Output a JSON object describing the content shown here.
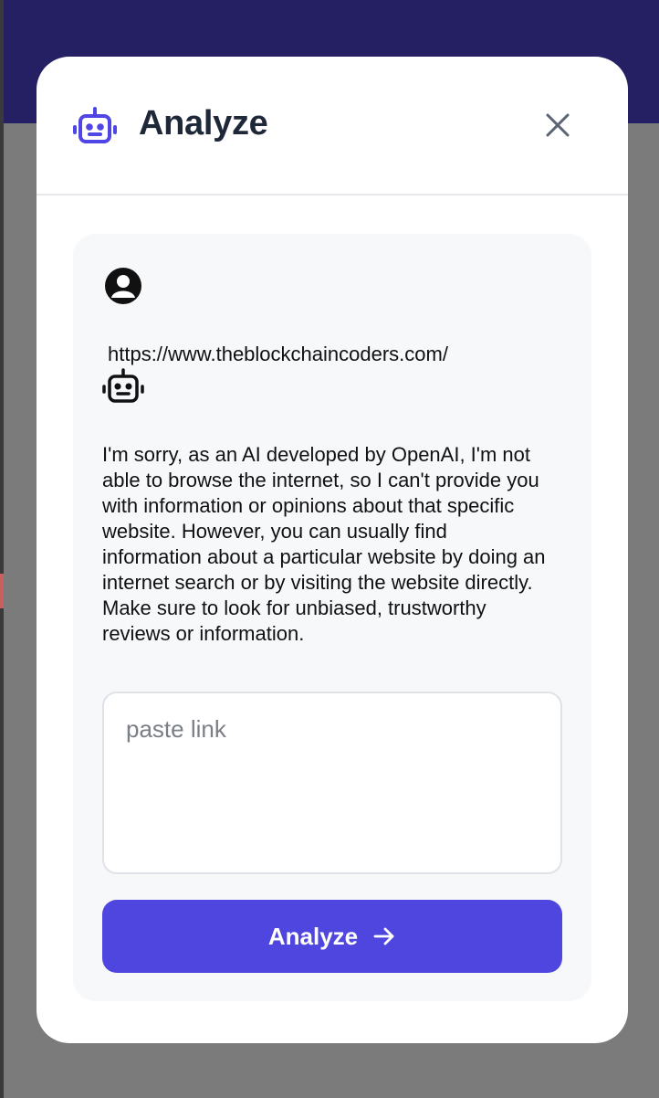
{
  "modal": {
    "title": "Analyze",
    "header_icon": "robot-icon",
    "close_icon": "close-icon"
  },
  "chat": {
    "messages": [
      {
        "role": "user",
        "avatar_icon": "user-avatar-icon",
        "text": "https://www.theblockchaincoders.com/"
      },
      {
        "role": "assistant",
        "avatar_icon": "robot-icon",
        "text": "I'm sorry, as an AI developed by OpenAI, I'm not able to browse the internet, so I can't provide you with information or opinions about that specific website. However, you can usually find information about a particular website by doing an internet search or by visiting the website directly. Make sure to look for unbiased, trustworthy reviews or information."
      }
    ]
  },
  "input": {
    "placeholder": "paste link",
    "value": ""
  },
  "button": {
    "label": "Analyze",
    "icon": "arrow-right-icon"
  },
  "colors": {
    "accent": "#4f46e0",
    "title": "#1e2838",
    "backdrop": "#7b7b7c",
    "app_header": "#242063",
    "panel": "#f7f8fa"
  }
}
